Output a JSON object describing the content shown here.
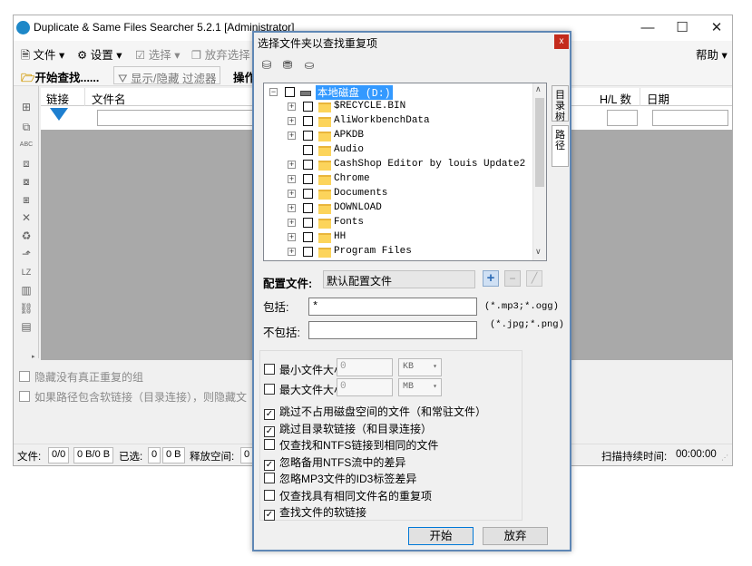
{
  "window": {
    "title": "Duplicate & Same Files Searcher 5.2.1 [Administrator]"
  },
  "menubar": {
    "items": [
      "文件",
      "设置",
      "选择",
      "放弃选择"
    ],
    "help": "帮助"
  },
  "toolbar": {
    "start_search": "开始查找......",
    "toggle_filter": "显示/隐藏 过滤器",
    "operation": "操作"
  },
  "grid": {
    "headers": [
      "链接",
      "文件名",
      "H/L 数",
      "日期"
    ]
  },
  "options": {
    "hide_no_dup": "隐藏没有真正重复的组",
    "soft_link_path": "如果路径包含软链接（目录连接），则隐藏文"
  },
  "statusbar": {
    "files_label": "文件:",
    "files_count": "0/0",
    "files_size": "0 B/0 B",
    "selected_label": "已选:",
    "selected_count": "0",
    "selected_size": "0 B",
    "free_label": "释放空间:",
    "free_value": "0",
    "scan_label": "扫描持续时间:",
    "scan_value": "00:00:00"
  },
  "dialog": {
    "title": "选择文件夹以查找重复项",
    "close": "x",
    "drive": "本地磁盘 (D:)",
    "folders": [
      "$RECYCLE.BIN",
      "AliWorkbenchData",
      "APKDB",
      "Audio",
      "CashShop Editor by louis Update2",
      "Chrome",
      "Documents",
      "DOWNLOAD",
      "Fonts",
      "HH",
      "Program Files"
    ],
    "side_tabs": [
      "目录树",
      "路径"
    ],
    "config_label": "配置文件:",
    "config_value": "默认配置文件",
    "include_label": "包括:",
    "include_value": "*",
    "include_hint": "(*.mp3;*.ogg)",
    "exclude_label": "不包括:",
    "exclude_value": "",
    "exclude_hint": "(*.jpg;*.png)",
    "min_size_label": "最小文件大小",
    "min_size_value": "0",
    "min_size_unit": "KB",
    "max_size_label": "最大文件大小",
    "max_size_value": "0",
    "max_size_unit": "MB",
    "checkboxes": [
      {
        "label": "跳过不占用磁盘空间的文件（和常驻文件）",
        "checked": true
      },
      {
        "label": "跳过目录软链接（和目录连接）",
        "checked": true
      },
      {
        "label": "仅查找和NTFS链接到相同的文件",
        "checked": false
      },
      {
        "label": "忽略备用NTFS流中的差异",
        "checked": true
      },
      {
        "label": "忽略MP3文件的ID3标签差异",
        "checked": false
      },
      {
        "label": "仅查找具有相同文件名的重复项",
        "checked": false
      },
      {
        "label": "查找文件的软链接",
        "checked": true
      }
    ],
    "start_button": "开始",
    "cancel_button": "放弃"
  },
  "colors": {
    "accent": "#5f87b5",
    "grid_bg": "#a9a9a9",
    "folder": "#fcd45b",
    "selection": "#3399ff"
  }
}
